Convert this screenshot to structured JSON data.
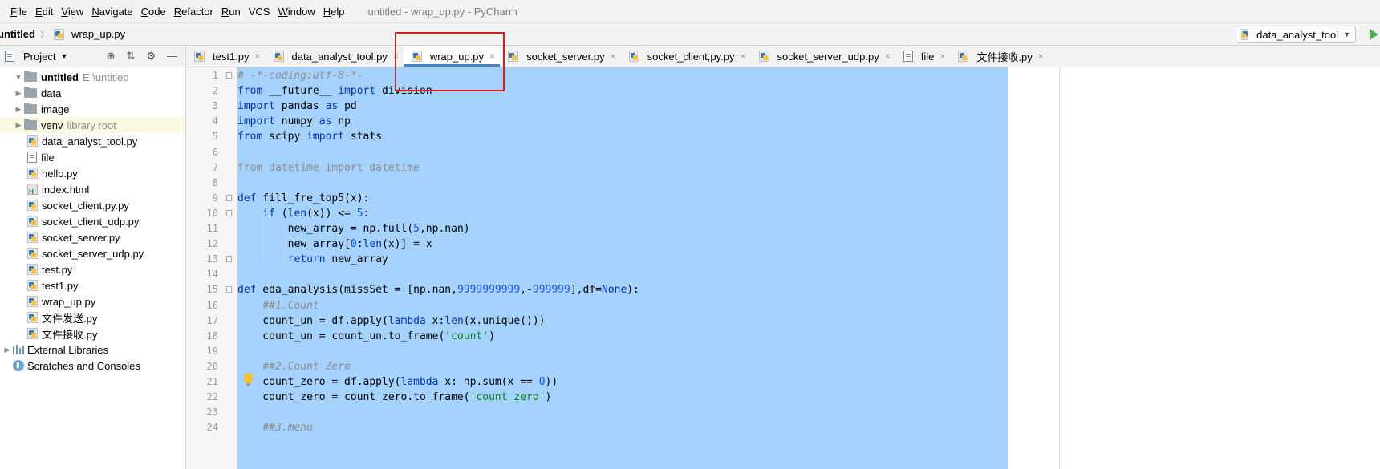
{
  "menubar": {
    "items": [
      "File",
      "Edit",
      "View",
      "Navigate",
      "Code",
      "Refactor",
      "Run",
      "VCS",
      "Window",
      "Help"
    ],
    "underline": [
      "F",
      "E",
      "V",
      "N",
      "C",
      "R",
      "R",
      "",
      "W",
      "H"
    ],
    "window_title": "untitled - wrap_up.py - PyCharm"
  },
  "navbar": {
    "project": "untitled",
    "file": "wrap_up.py",
    "run_config": "data_analyst_tool"
  },
  "project_panel": {
    "title": "Project",
    "root": {
      "name": "untitled",
      "path": "E:\\untitled"
    },
    "folders": [
      {
        "name": "data"
      },
      {
        "name": "image"
      },
      {
        "name": "venv",
        "note": "library root"
      }
    ],
    "files": [
      {
        "name": "data_analyst_tool.py",
        "type": "py"
      },
      {
        "name": "file",
        "type": "text"
      },
      {
        "name": "hello.py",
        "type": "py"
      },
      {
        "name": "index.html",
        "type": "html"
      },
      {
        "name": "socket_client,py.py",
        "type": "py"
      },
      {
        "name": "socket_client_udp.py",
        "type": "py"
      },
      {
        "name": "socket_server.py",
        "type": "py"
      },
      {
        "name": "socket_server_udp.py",
        "type": "py"
      },
      {
        "name": "test.py",
        "type": "py"
      },
      {
        "name": "test1.py",
        "type": "py"
      },
      {
        "name": "wrap_up.py",
        "type": "py"
      },
      {
        "name": "文件发送.py",
        "type": "py"
      },
      {
        "name": "文件接收.py",
        "type": "py"
      }
    ],
    "external_libraries": "External Libraries",
    "scratches": "Scratches and Consoles"
  },
  "tabs": [
    {
      "label": "test1.py",
      "active": false
    },
    {
      "label": "data_analyst_tool.py",
      "active": false
    },
    {
      "label": "wrap_up.py",
      "active": true
    },
    {
      "label": "socket_server.py",
      "active": false
    },
    {
      "label": "socket_client,py.py",
      "active": false
    },
    {
      "label": "socket_server_udp.py",
      "active": false
    },
    {
      "label": "file",
      "active": false
    },
    {
      "label": "文件接收.py",
      "active": false
    }
  ],
  "editor": {
    "line_numbers": [
      "1",
      "2",
      "3",
      "4",
      "5",
      "6",
      "7",
      "8",
      "9",
      "10",
      "11",
      "12",
      "13",
      "14",
      "15",
      "16",
      "17",
      "18",
      "19",
      "20",
      "21",
      "22",
      "23",
      "24"
    ],
    "lines": [
      [
        [
          "cm",
          "# -*-coding:utf-8-*-"
        ]
      ],
      [
        [
          "kw",
          "from"
        ],
        [
          "",
          " __future__ "
        ],
        [
          "kw",
          "import"
        ],
        [
          "",
          " division"
        ]
      ],
      [
        [
          "kw",
          "import"
        ],
        [
          "",
          " pandas "
        ],
        [
          "kw",
          "as"
        ],
        [
          "",
          " pd"
        ]
      ],
      [
        [
          "kw",
          "import"
        ],
        [
          "",
          " numpy "
        ],
        [
          "kw",
          "as"
        ],
        [
          "",
          " np"
        ]
      ],
      [
        [
          "kw",
          "from"
        ],
        [
          "",
          " scipy "
        ],
        [
          "kw",
          "import"
        ],
        [
          "",
          " stats"
        ]
      ],
      [],
      [
        [
          "dim",
          "from datetime import datetime"
        ]
      ],
      [],
      [
        [
          "kw",
          "def"
        ],
        [
          "",
          " fill_fre_top5(x):"
        ]
      ],
      [
        [
          "",
          "    "
        ],
        [
          "kw",
          "if"
        ],
        [
          "",
          " ("
        ],
        [
          "kw",
          "len"
        ],
        [
          "",
          "(x)) <= "
        ],
        [
          "num",
          "5"
        ],
        [
          "",
          ":"
        ]
      ],
      [
        [
          "",
          "        new_array = np.full("
        ],
        [
          "num",
          "5"
        ],
        [
          "",
          ",np.nan)"
        ]
      ],
      [
        [
          "",
          "        new_array["
        ],
        [
          "num",
          "0"
        ],
        [
          "",
          ":"
        ],
        [
          "kw",
          "len"
        ],
        [
          "",
          "(x)] = x"
        ]
      ],
      [
        [
          "",
          "        "
        ],
        [
          "kw",
          "return"
        ],
        [
          "",
          " new_array"
        ]
      ],
      [],
      [
        [
          "kw",
          "def"
        ],
        [
          "",
          " eda_analysis(missSet = [np.nan,"
        ],
        [
          "num",
          "9999999999"
        ],
        [
          "",
          ",-"
        ],
        [
          "num",
          "999999"
        ],
        [
          "",
          "],df="
        ],
        [
          "kw",
          "None"
        ],
        [
          "",
          "):"
        ]
      ],
      [
        [
          "",
          "    "
        ],
        [
          "cm",
          "##1.Count"
        ]
      ],
      [
        [
          "",
          "    count_un = df.apply("
        ],
        [
          "kw",
          "lambda"
        ],
        [
          "",
          " x:"
        ],
        [
          "kw",
          "len"
        ],
        [
          "",
          "(x.unique()))"
        ]
      ],
      [
        [
          "",
          "    count_un = count_un.to_frame("
        ],
        [
          "str",
          "'count'"
        ],
        [
          "",
          ")"
        ]
      ],
      [],
      [
        [
          "",
          "    "
        ],
        [
          "cm",
          "##2.Count Zero"
        ]
      ],
      [
        [
          "",
          "    count_zero = df.apply("
        ],
        [
          "kw",
          "lambda"
        ],
        [
          "",
          " x: np.sum(x == "
        ],
        [
          "num",
          "0"
        ],
        [
          "",
          "))"
        ]
      ],
      [
        [
          "",
          "    count_zero = count_zero.to_frame("
        ],
        [
          "str",
          "'count_zero'"
        ],
        [
          "",
          ")"
        ]
      ],
      [],
      [
        [
          "",
          "    "
        ],
        [
          "cm",
          "##3.menu"
        ]
      ]
    ]
  }
}
